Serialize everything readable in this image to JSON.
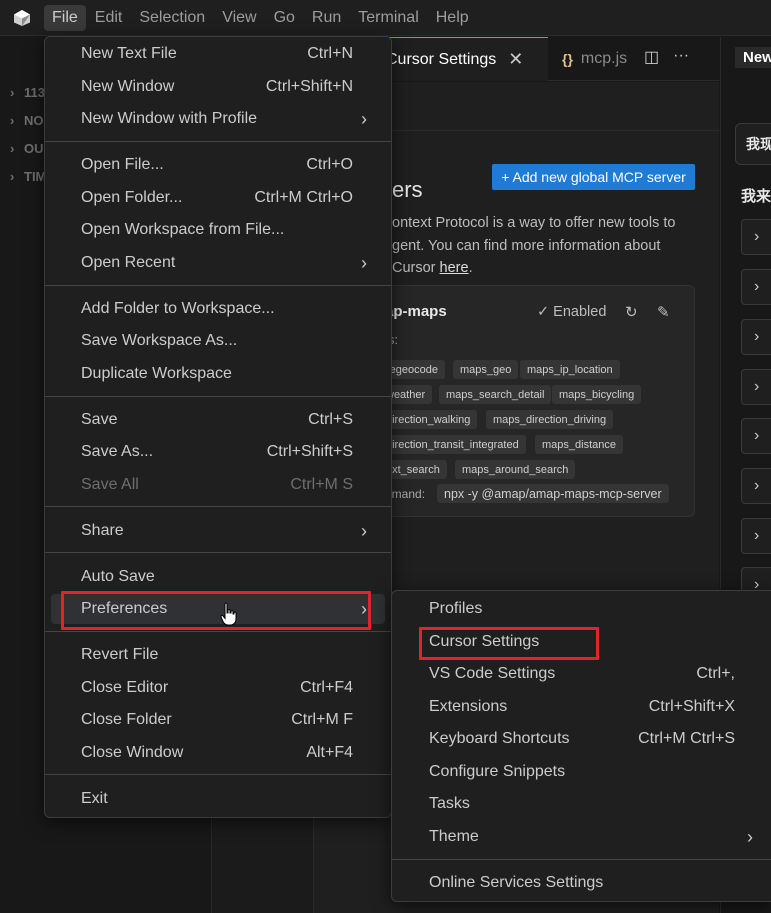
{
  "menubar": {
    "items": [
      "File",
      "Edit",
      "Selection",
      "View",
      "Go",
      "Run",
      "Terminal",
      "Help"
    ],
    "active": "File"
  },
  "sidebar": {
    "rows": [
      {
        "label": "113"
      },
      {
        "label": "NO"
      },
      {
        "label": "OU"
      },
      {
        "label": "TIM"
      }
    ]
  },
  "tabs": {
    "active_label": "Cursor Settings",
    "inactive_label": "mcp.js",
    "inactive_icon": "{}",
    "right_tab_label": "New"
  },
  "mcp": {
    "title": "ers",
    "add_button": "+ Add new global MCP server",
    "desc_line1": "ontext Protocol is a way to offer new tools to",
    "desc_line2": "gent. You can find more information about",
    "desc_line3_prefix": "Cursor ",
    "desc_link": "here",
    "desc_line3_suffix": ".",
    "server": {
      "name": "ap-maps",
      "enabled_label": "✓ Enabled",
      "tools_label": "ls:",
      "tools": [
        [
          "regeocode",
          "maps_geo",
          "maps_ip_location"
        ],
        [
          "weather",
          "maps_search_detail",
          "maps_bicycling"
        ],
        [
          "direction_walking",
          "maps_direction_driving"
        ],
        [
          "direction_transit_integrated",
          "maps_distance"
        ],
        [
          "ext_search",
          "maps_around_search"
        ]
      ],
      "command_label": "nmand:",
      "command": "npx -y @amap/amap-maps-mcp-server"
    }
  },
  "chat": {
    "input_text": "我现",
    "intro_text": "我来"
  },
  "file_menu": {
    "groups": [
      [
        {
          "label": "New Text File",
          "shortcut": "Ctrl+N"
        },
        {
          "label": "New Window",
          "shortcut": "Ctrl+Shift+N"
        },
        {
          "label": "New Window with Profile",
          "submenu": true
        }
      ],
      [
        {
          "label": "Open File...",
          "shortcut": "Ctrl+O"
        },
        {
          "label": "Open Folder...",
          "shortcut": "Ctrl+M Ctrl+O"
        },
        {
          "label": "Open Workspace from File..."
        },
        {
          "label": "Open Recent",
          "submenu": true
        }
      ],
      [
        {
          "label": "Add Folder to Workspace..."
        },
        {
          "label": "Save Workspace As..."
        },
        {
          "label": "Duplicate Workspace"
        }
      ],
      [
        {
          "label": "Save",
          "shortcut": "Ctrl+S"
        },
        {
          "label": "Save As...",
          "shortcut": "Ctrl+Shift+S"
        },
        {
          "label": "Save All",
          "shortcut": "Ctrl+M S",
          "disabled": true
        }
      ],
      [
        {
          "label": "Share",
          "submenu": true
        }
      ],
      [
        {
          "label": "Auto Save"
        },
        {
          "label": "Preferences",
          "submenu": true,
          "highlighted": true
        }
      ],
      [
        {
          "label": "Revert File"
        },
        {
          "label": "Close Editor",
          "shortcut": "Ctrl+F4"
        },
        {
          "label": "Close Folder",
          "shortcut": "Ctrl+M F"
        },
        {
          "label": "Close Window",
          "shortcut": "Alt+F4"
        }
      ],
      [
        {
          "label": "Exit"
        }
      ]
    ]
  },
  "preferences_menu": {
    "items": [
      {
        "label": "Profiles"
      },
      {
        "label": "Cursor Settings"
      },
      {
        "label": "VS Code Settings",
        "shortcut": "Ctrl+,"
      },
      {
        "label": "Extensions",
        "shortcut": "Ctrl+Shift+X"
      },
      {
        "label": "Keyboard Shortcuts",
        "shortcut": "Ctrl+M Ctrl+S"
      },
      {
        "label": "Configure Snippets"
      },
      {
        "label": "Tasks"
      },
      {
        "label": "Theme",
        "submenu": true
      },
      {
        "label": "Online Services Settings"
      }
    ]
  },
  "colors": {
    "accent": "#1f7cd6",
    "annotation_red": "#e0242b",
    "menu_bg": "#1f1f1f"
  }
}
